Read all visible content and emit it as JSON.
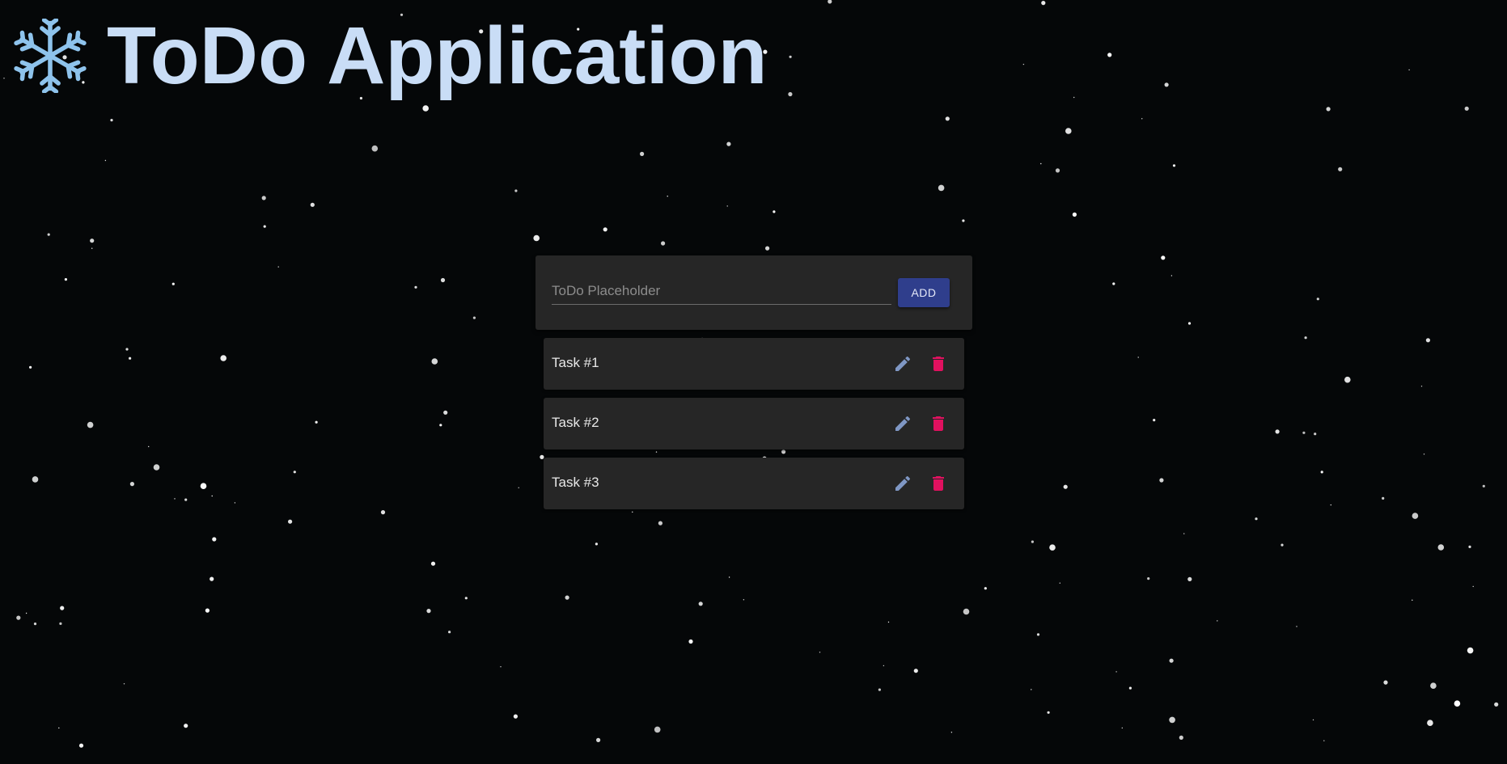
{
  "header": {
    "title": "ToDo Application",
    "icon": "snowflake-icon",
    "title_color": "#c9ddf6",
    "icon_color": "#8ec3ec"
  },
  "todo_form": {
    "placeholder": "ToDo Placeholder",
    "value": "",
    "add_label": "ADD",
    "add_color": "#2f3e8c"
  },
  "tasks": [
    {
      "label": "Task #1",
      "edit_icon": "pencil-icon",
      "delete_icon": "trash-icon"
    },
    {
      "label": "Task #2",
      "edit_icon": "pencil-icon",
      "delete_icon": "trash-icon"
    },
    {
      "label": "Task #3",
      "edit_icon": "pencil-icon",
      "delete_icon": "trash-icon"
    }
  ],
  "colors": {
    "background": "#050708",
    "card": "#262626",
    "edit_icon": "#7f97c4",
    "delete_icon": "#e0115f",
    "snow": "#ffffff"
  }
}
